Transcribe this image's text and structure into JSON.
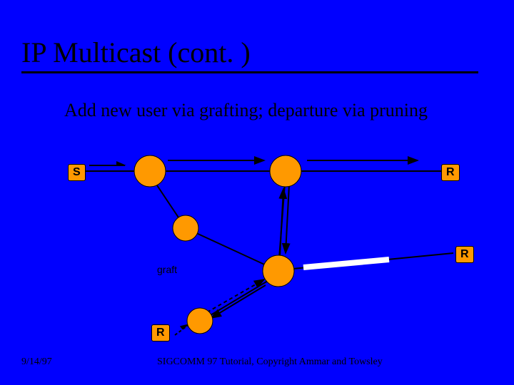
{
  "title": "IP Multicast (cont. )",
  "subtitle": "Add new user via grafting; departure via pruning",
  "nodes": {
    "s": "S",
    "r1": "R",
    "r2": "R",
    "r3": "R"
  },
  "graft_label": "graft",
  "footer": {
    "date": "9/14/97",
    "credit": "SIGCOMM 97 Tutorial, Copyright Ammar and Towsley"
  }
}
